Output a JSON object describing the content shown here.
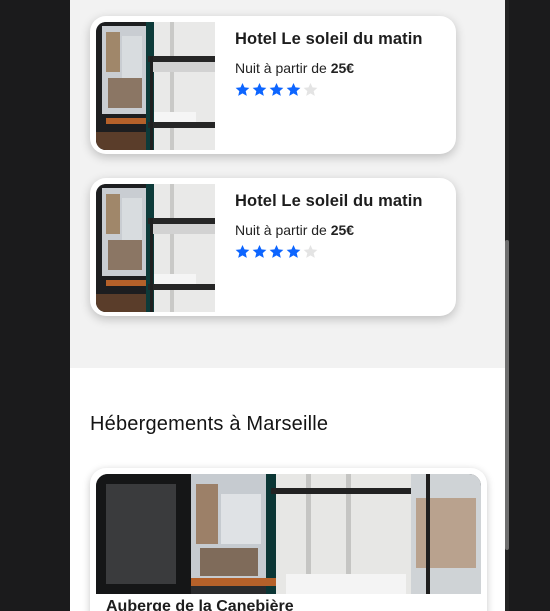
{
  "hotels": [
    {
      "name": "Hotel Le soleil du matin",
      "price_prefix": "Nuit à partir de ",
      "price": "25€",
      "rating": 4,
      "max_rating": 5
    },
    {
      "name": "Hotel Le soleil du matin",
      "price_prefix": "Nuit à partir de ",
      "price": "25€",
      "rating": 4,
      "max_rating": 5
    }
  ],
  "section": {
    "title": "Hébergements à Marseille",
    "first_card_title": "Auberge de la Canebière"
  },
  "colors": {
    "star_filled": "#0d65ff",
    "star_empty": "#e4e4e4",
    "page_bg": "#1b1b1c",
    "list_bg": "#f2f2f2"
  },
  "icons": [
    "star-icon",
    "room-photo"
  ]
}
